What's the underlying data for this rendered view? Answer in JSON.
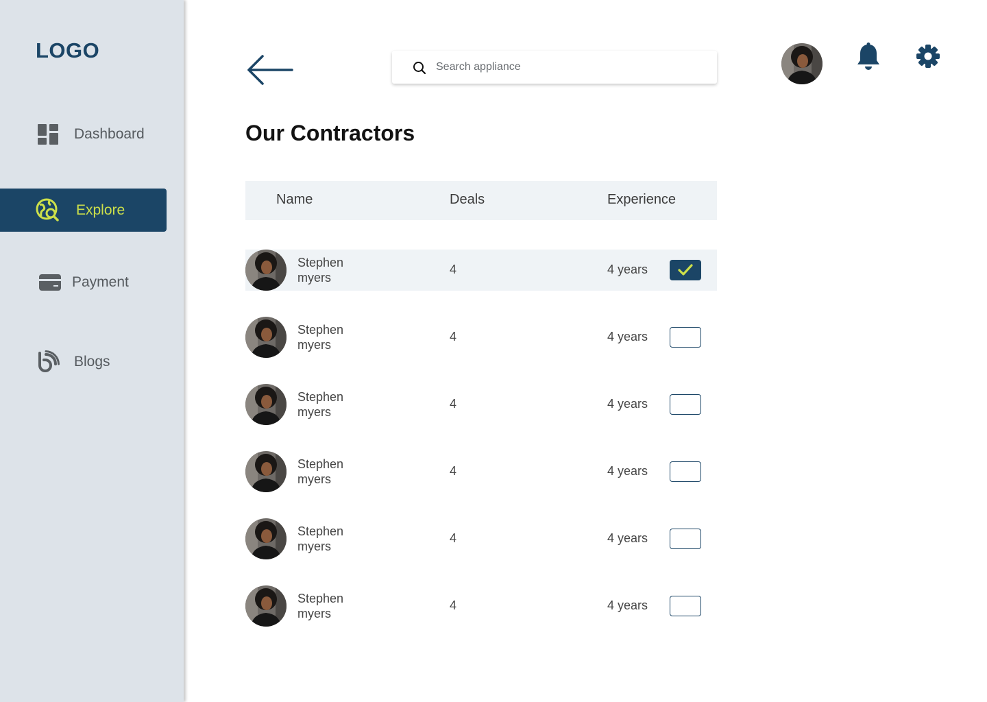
{
  "sidebar": {
    "logo": "LOGO",
    "items": [
      {
        "label": "Dashboard",
        "icon": "dashboard-icon",
        "active": false
      },
      {
        "label": "Explore",
        "icon": "explore-icon",
        "active": true
      },
      {
        "label": "Payment",
        "icon": "payment-card-icon",
        "active": false
      },
      {
        "label": "Blogs",
        "icon": "blog-icon",
        "active": false
      }
    ]
  },
  "header": {
    "back_icon": "arrow-left-icon",
    "search": {
      "placeholder": "Search appliance",
      "value": ""
    },
    "notification_icon": "bell-icon",
    "settings_icon": "gear-icon"
  },
  "main": {
    "title": "Our Contractors",
    "columns": [
      "Name",
      "Deals",
      "Experience"
    ],
    "rows": [
      {
        "first": "Stephen",
        "last": "myers",
        "deals": "4",
        "experience": "4 years",
        "checked": true
      },
      {
        "first": "Stephen",
        "last": "myers",
        "deals": "4",
        "experience": "4 years",
        "checked": false
      },
      {
        "first": "Stephen",
        "last": "myers",
        "deals": "4",
        "experience": "4 years",
        "checked": false
      },
      {
        "first": "Stephen",
        "last": "myers",
        "deals": "4",
        "experience": "4 years",
        "checked": false
      },
      {
        "first": "Stephen",
        "last": "myers",
        "deals": "4",
        "experience": "4 years",
        "checked": false
      },
      {
        "first": "Stephen",
        "last": "myers",
        "deals": "4",
        "experience": "4 years",
        "checked": false
      }
    ]
  },
  "colors": {
    "primary": "#1b4566",
    "accent": "#cde04a",
    "sidebar_bg": "#dde3e9",
    "header_row_bg": "#eff3f6"
  }
}
